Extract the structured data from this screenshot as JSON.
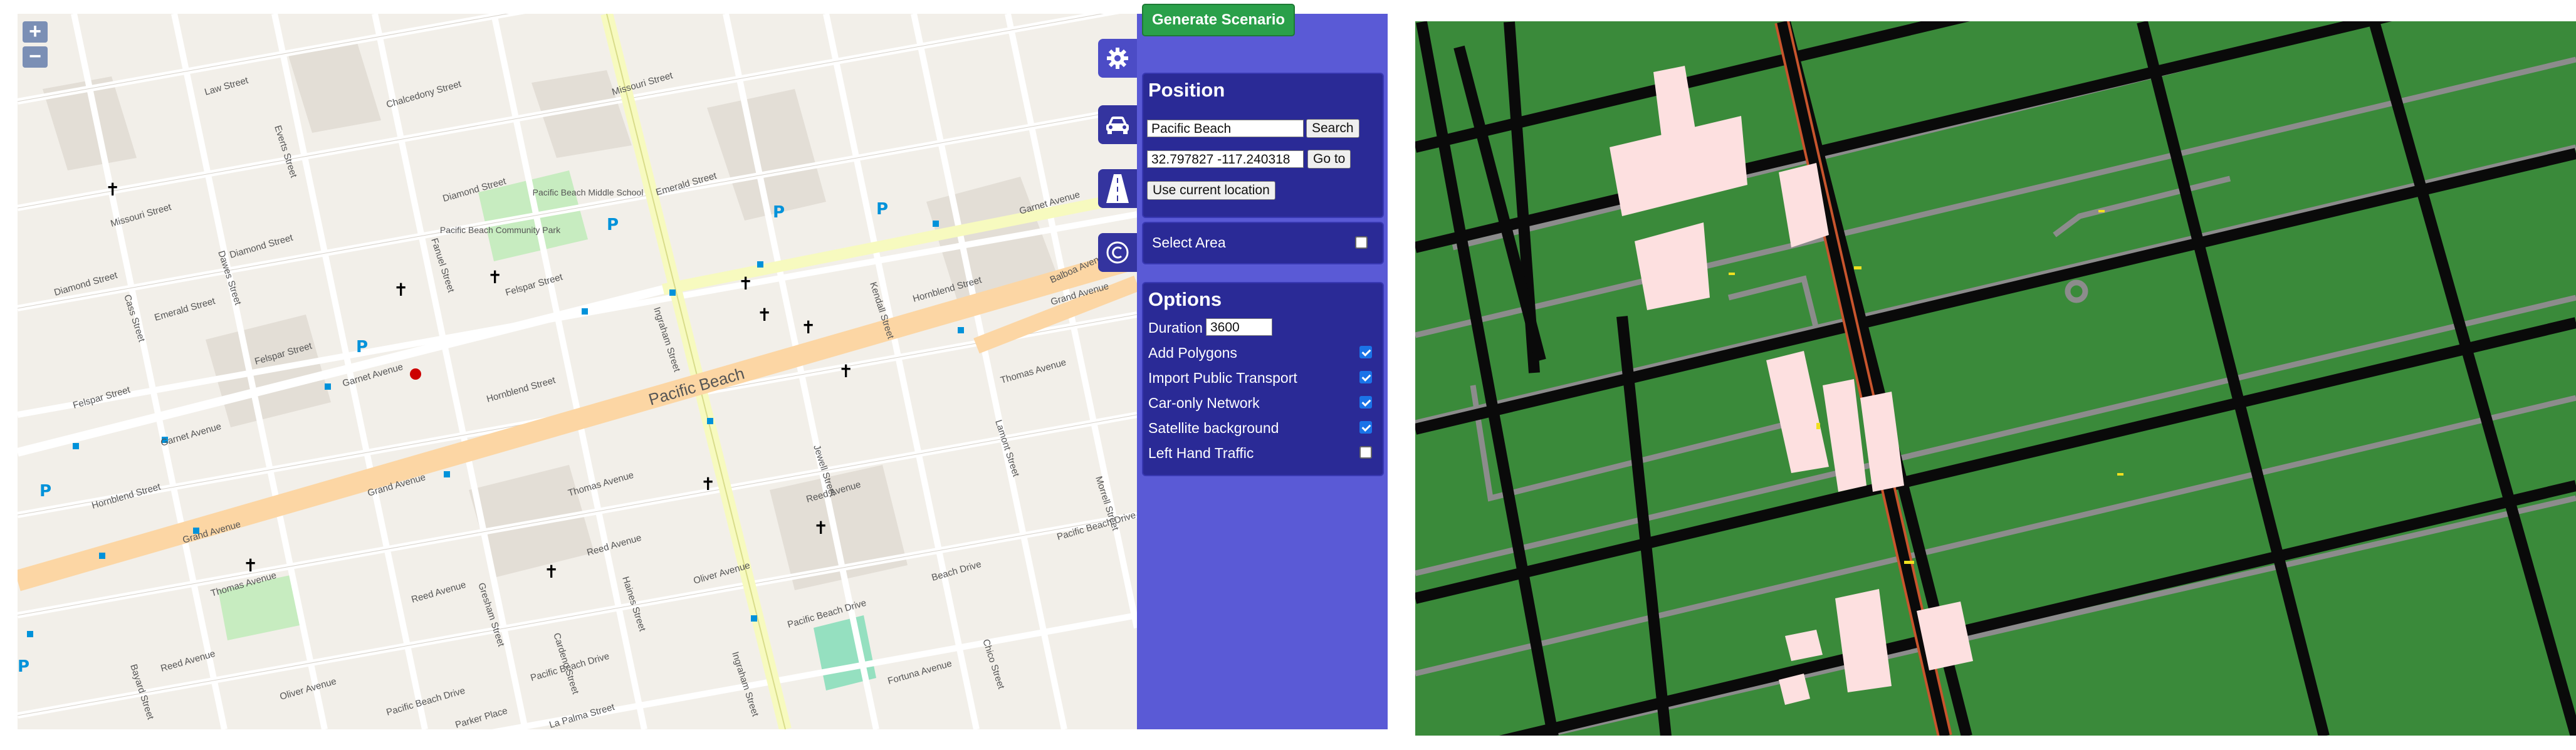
{
  "zoom": {
    "in_label": "+",
    "out_label": "−"
  },
  "map": {
    "place_label": "Pacific Beach",
    "park_label": "Pacific Beach Community Park",
    "school_label": "Pacific Beach Middle School",
    "streets": {
      "grand_avenue": "Grand Avenue",
      "garnet_avenue": "Garnet Avenue",
      "hornblend": "Hornblend Street",
      "felspar": "Felspar Street",
      "emerald": "Emerald Street",
      "diamond": "Diamond Street",
      "chalcedony": "Chalcedony Street",
      "missouri": "Missouri Street",
      "law": "Law Street",
      "thomas": "Thomas Avenue",
      "reed": "Reed Avenue",
      "oliver": "Oliver Avenue",
      "pacific_beach_drive": "Pacific Beach Drive",
      "la_palma": "La Palma Street",
      "parker": "Parker Place",
      "fortuna": "Fortuna Avenue",
      "balboa": "Balboa Avenue",
      "ingraham": "Ingraham Street",
      "jewell": "Jewell Street",
      "kendall": "Kendall Street",
      "lamont": "Lamont Street",
      "morrell": "Morrell Street",
      "fanuel": "Fanuel Street",
      "everts": "Everts Street",
      "dawes": "Dawes Street",
      "cass": "Cass Street",
      "bayard": "Bayard Street",
      "haines": "Haines Street",
      "gresham": "Gresham Street",
      "chico": "Chico Street",
      "beach_drive": "Beach Drive",
      "cardeno": "Cardeno Street"
    }
  },
  "toolbar": {
    "generate_label": "Generate Scenario"
  },
  "tabs": [
    {
      "icon": "gear-icon"
    },
    {
      "icon": "car-icon"
    },
    {
      "icon": "road-icon"
    },
    {
      "icon": "copyright-icon"
    }
  ],
  "position": {
    "title": "Position",
    "search_value": "Pacific Beach",
    "search_button": "Search",
    "coords_value": "32.797827 -117.240318",
    "goto_button": "Go to",
    "current_location_button": "Use current location"
  },
  "select_area": {
    "label": "Select Area",
    "checked": false
  },
  "options": {
    "title": "Options",
    "duration_label": "Duration",
    "duration_value": "3600",
    "items": [
      {
        "label": "Add Polygons",
        "checked": true
      },
      {
        "label": "Import Public Transport",
        "checked": true
      },
      {
        "label": "Car-only Network",
        "checked": true
      },
      {
        "label": "Satellite background",
        "checked": true
      },
      {
        "label": "Left Hand Traffic",
        "checked": false
      }
    ]
  },
  "colors": {
    "wizard_bg": "#5a5ad6",
    "panel_bg": "#2a2a96",
    "generate_button": "#2aa04a",
    "sumo_background": "#3a8a3a"
  }
}
